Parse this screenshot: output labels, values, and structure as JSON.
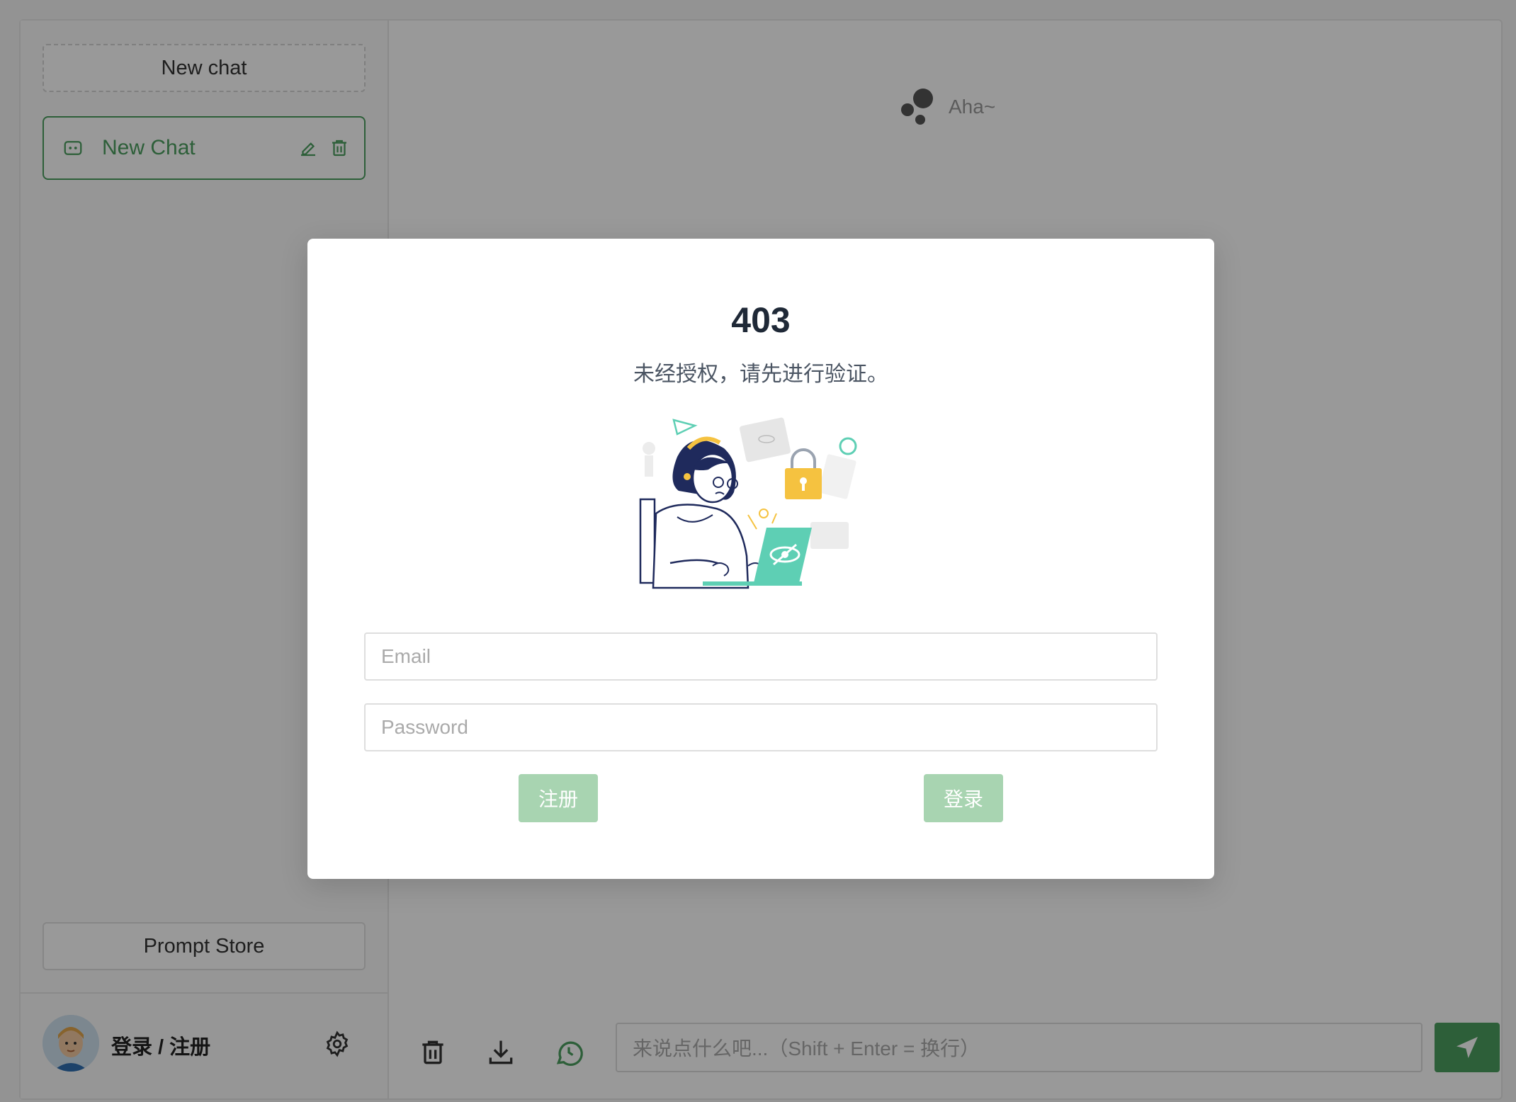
{
  "sidebar": {
    "new_chat_label": "New chat",
    "chats": [
      {
        "title": "New Chat"
      }
    ],
    "prompt_store_label": "Prompt Store",
    "user": {
      "login_label": "登录 / 注册"
    }
  },
  "header": {
    "logo_text": "Aha~"
  },
  "chat_input": {
    "placeholder": "来说点什么吧...（Shift + Enter = 换行）"
  },
  "modal": {
    "code": "403",
    "message": "未经授权，请先进行验证。",
    "email_placeholder": "Email",
    "password_placeholder": "Password",
    "register_label": "注册",
    "login_label": "登录"
  },
  "colors": {
    "accent": "#4b9e5f",
    "button_disabled": "#a8d4b1",
    "overlay": "rgba(0,0,0,0.40)"
  }
}
